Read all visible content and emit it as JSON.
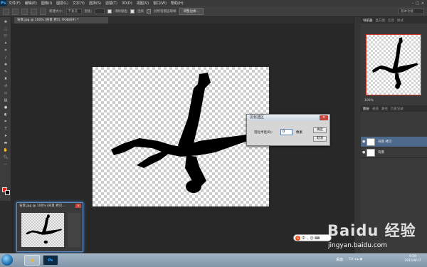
{
  "app": {
    "logo": "Ps"
  },
  "menubar": {
    "items": [
      "文件(F)",
      "编辑(E)",
      "图像(I)",
      "图层(L)",
      "文字(Y)",
      "选择(S)",
      "滤镜(T)",
      "3D(D)",
      "视图(V)",
      "窗口(W)",
      "帮助(H)"
    ],
    "window_controls": [
      "–",
      "□",
      "×"
    ]
  },
  "options": {
    "size_label": "新建大小:",
    "size_value": "不复选",
    "mode_label": "羽化:",
    "anti_alias_label": "消除锯齿",
    "style_label": "连续",
    "sample_all_label": "对所有图层取样",
    "refine_button": "调整边缘...",
    "workspace": "基本功能"
  },
  "document": {
    "tab_title": "背景.jpg @ 100% (背景 拷贝, RGB/8#) *"
  },
  "dialog": {
    "title": "羽化选区",
    "close_label": "×",
    "radius_label": "羽化半径(R):",
    "radius_value": "0",
    "unit": "像素",
    "ok_label": "确定",
    "cancel_label": "取消"
  },
  "panels": {
    "top_tabs": [
      "导航器",
      "直方图",
      "信息",
      "样式"
    ],
    "zoom": "100%",
    "layer_tabs": [
      "图层",
      "通道",
      "路径",
      "历史记录"
    ],
    "layers": [
      {
        "name": "背景 拷贝",
        "selected": true
      },
      {
        "name": "背景",
        "selected": false
      }
    ]
  },
  "mini_window": {
    "title": "背景.jpg @ 100% (背景 拷贝...",
    "close_label": "×"
  },
  "ime": {
    "logo": "S",
    "label": "中 ·, ☺ ⌨"
  },
  "taskbar": {
    "desk_label": "桌面",
    "tray": "CH ◂ ▴ ◉",
    "time": "9:59",
    "date": "2015/8/17",
    "ps_label": "Ps"
  },
  "watermark": {
    "brand": "Baidu 经验",
    "url": "jingyan.baidu.com"
  },
  "colors": {
    "foreground": "#e2231a",
    "background": "#000000",
    "accent": "#31a8ff"
  }
}
